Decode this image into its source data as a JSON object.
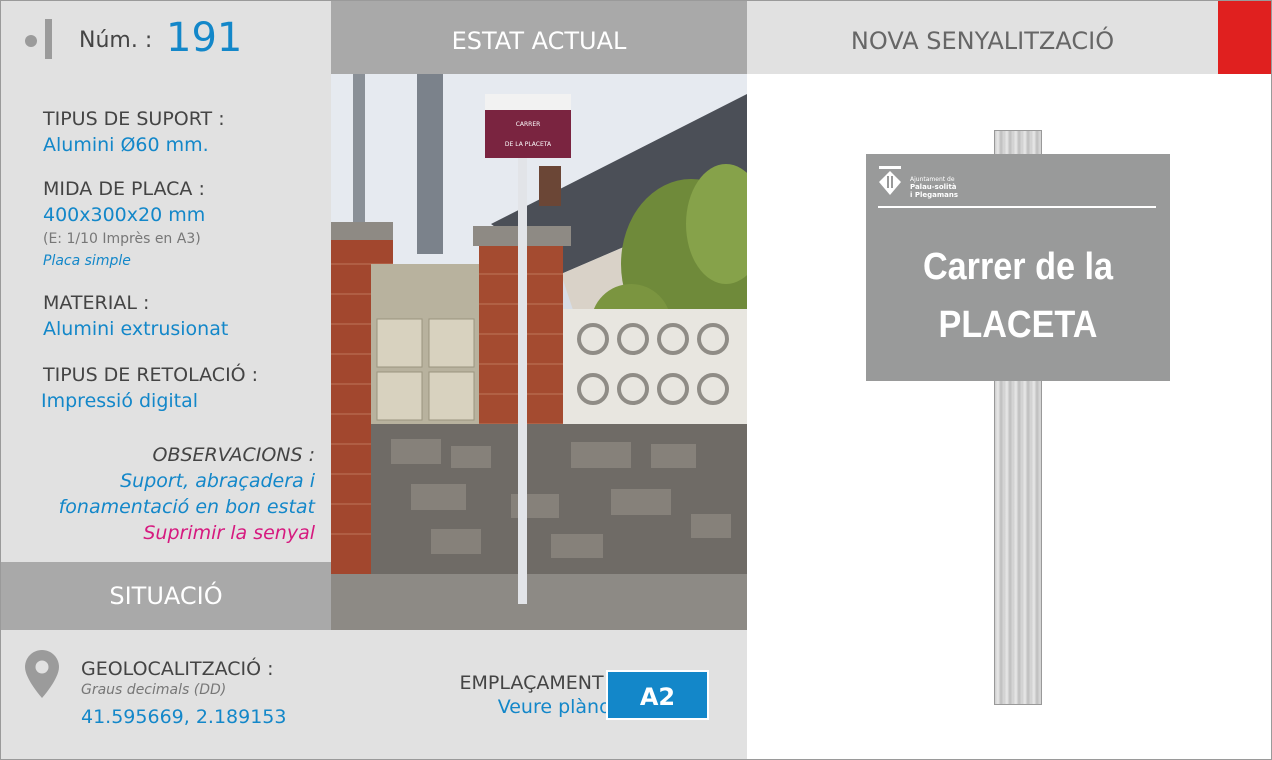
{
  "header": {
    "num_label": "Núm. :",
    "num_value": "191",
    "estat_actual": "ESTAT ACTUAL",
    "nova_senyalitzacio": "NOVA SENYALITZACIÓ"
  },
  "info": {
    "tipus_suport_label": "TIPUS DE SUPORT :",
    "tipus_suport_value": "Alumini Ø60 mm.",
    "mida_placa_label": "MIDA DE PLACA :",
    "mida_placa_value": "400x300x20 mm",
    "mida_placa_note": "(E: 1/10 Imprès en A3)",
    "mida_placa_type": "Placa simple",
    "material_label": "MATERIAL :",
    "material_value": "Alumini extrusionat",
    "retolacio_label": "TIPUS DE RETOLACIÓ :",
    "retolacio_value": "Impressió digital",
    "observacions_label": "OBSERVACIONS :",
    "observacions_line1": "Suport, abraçadera i",
    "observacions_line2": "fonamentació en bon estat",
    "observacions_action": "Suprimir la senyal"
  },
  "situacio": "SITUACIÓ",
  "geo": {
    "label": "GEOLOCALITZACIÓ :",
    "note": "Graus decimals (DD)",
    "value": "41.595669, 2.189153",
    "pin_icon": "location-pin-icon"
  },
  "emplacament": {
    "label": "EMPLAÇAMENT :",
    "value": "Veure plànol",
    "badge": "A2"
  },
  "photo": {
    "sign_line1": "CARRER",
    "sign_line2": "DE LA PLACETA"
  },
  "new_sign": {
    "logo_small": "Ajuntament de",
    "logo_name1": "Palau-solità",
    "logo_name2": "i Plegamans",
    "line1": "Carrer de la",
    "line2": "PLACETA"
  },
  "colors": {
    "accent_blue": "#1387c9",
    "magenta": "#d6197f",
    "red": "#e0201f",
    "panel_gray": "#e1e1e1",
    "header_gray": "#a9a9a9",
    "sign_gray": "#999a9a"
  }
}
